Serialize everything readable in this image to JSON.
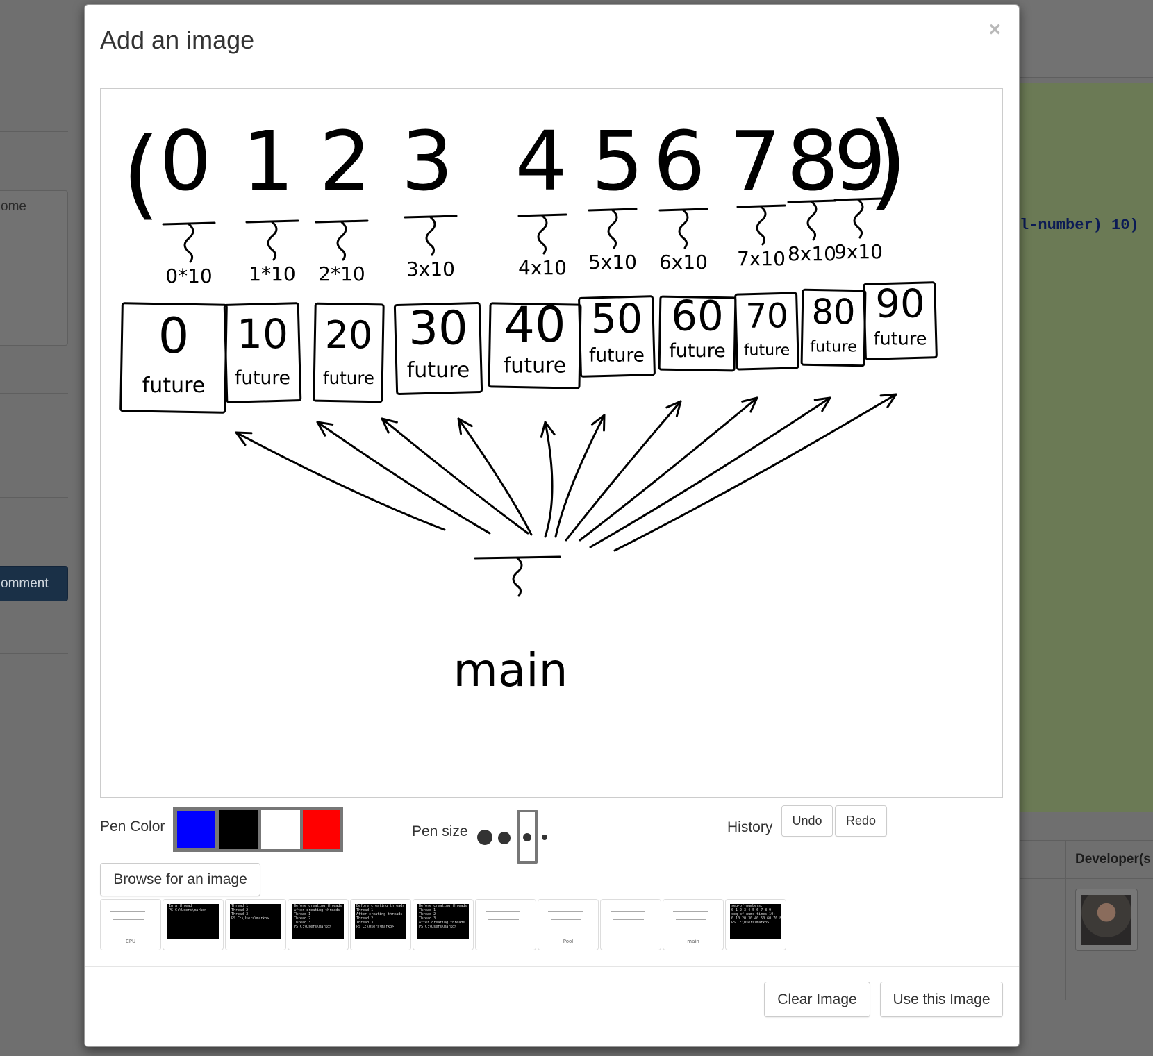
{
  "background": {
    "textarea_partial": "ome",
    "comment_button_partial": "omment",
    "code_partial": "l-number) 10)",
    "table_header_partial": "Developer(s"
  },
  "modal": {
    "title": "Add an image",
    "close_glyph": "×",
    "drawing": {
      "parens": [
        "(",
        ")"
      ],
      "digits": [
        "0",
        "1",
        "2",
        "3",
        "4",
        "5",
        "6",
        "7",
        "8",
        "9"
      ],
      "products": [
        "0*10",
        "1*10",
        "2*10",
        "3x10",
        "4x10",
        "5x10",
        "6x10",
        "7x10",
        "8x10",
        "9x10"
      ],
      "results": [
        "0",
        "10",
        "20",
        "30",
        "40",
        "50",
        "60",
        "70",
        "80",
        "90"
      ],
      "future_label": "future",
      "main_label": "main",
      "ink_color": "#000000"
    },
    "pen_color_label": "Pen Color",
    "pen_colors": [
      "#0000ff",
      "#000000",
      "#ffffff",
      "#ff0000"
    ],
    "pen_size_label": "Pen size",
    "history_label": "History",
    "undo_label": "Undo",
    "redo_label": "Redo",
    "browse_label": "Browse for an image",
    "thumbnails": [
      {
        "kind": "light",
        "lines": [
          "CPU"
        ]
      },
      {
        "kind": "dark",
        "lines": [
          "In a thread",
          "PS C:\\Users\\marko>"
        ]
      },
      {
        "kind": "dark",
        "lines": [
          "Thread 1",
          "Thread 2",
          "Thread 3",
          "PS C:\\Users\\marko>"
        ]
      },
      {
        "kind": "dark",
        "lines": [
          "Before creating threads",
          "After creating threads",
          "Thread 1",
          "Thread 2",
          "Thread 3",
          "PS C:\\Users\\marko>"
        ]
      },
      {
        "kind": "dark",
        "lines": [
          "Before creating threads",
          "Thread 1",
          "After creating threads",
          "Thread 2",
          "Thread 3",
          "PS C:\\Users\\marko>"
        ]
      },
      {
        "kind": "dark",
        "lines": [
          "Before creating threads",
          "Thread 1",
          "Thread 2",
          "Thread 3",
          "After creating threads",
          "PS C:\\Users\\marko>"
        ]
      },
      {
        "kind": "light",
        "lines": []
      },
      {
        "kind": "light",
        "lines": [
          "Pool"
        ]
      },
      {
        "kind": "light",
        "lines": []
      },
      {
        "kind": "light",
        "lines": [
          "main"
        ]
      },
      {
        "kind": "dark",
        "lines": [
          "seq-of-numbers:",
          "0 1 2 3 4 5 6 7 8 9",
          "seq-of-nums-times-10:",
          "0 10 20 30 40 50 60 70 80 90",
          "PS C:\\Users\\marko>"
        ]
      }
    ],
    "clear_label": "Clear Image",
    "use_label": "Use this Image"
  }
}
